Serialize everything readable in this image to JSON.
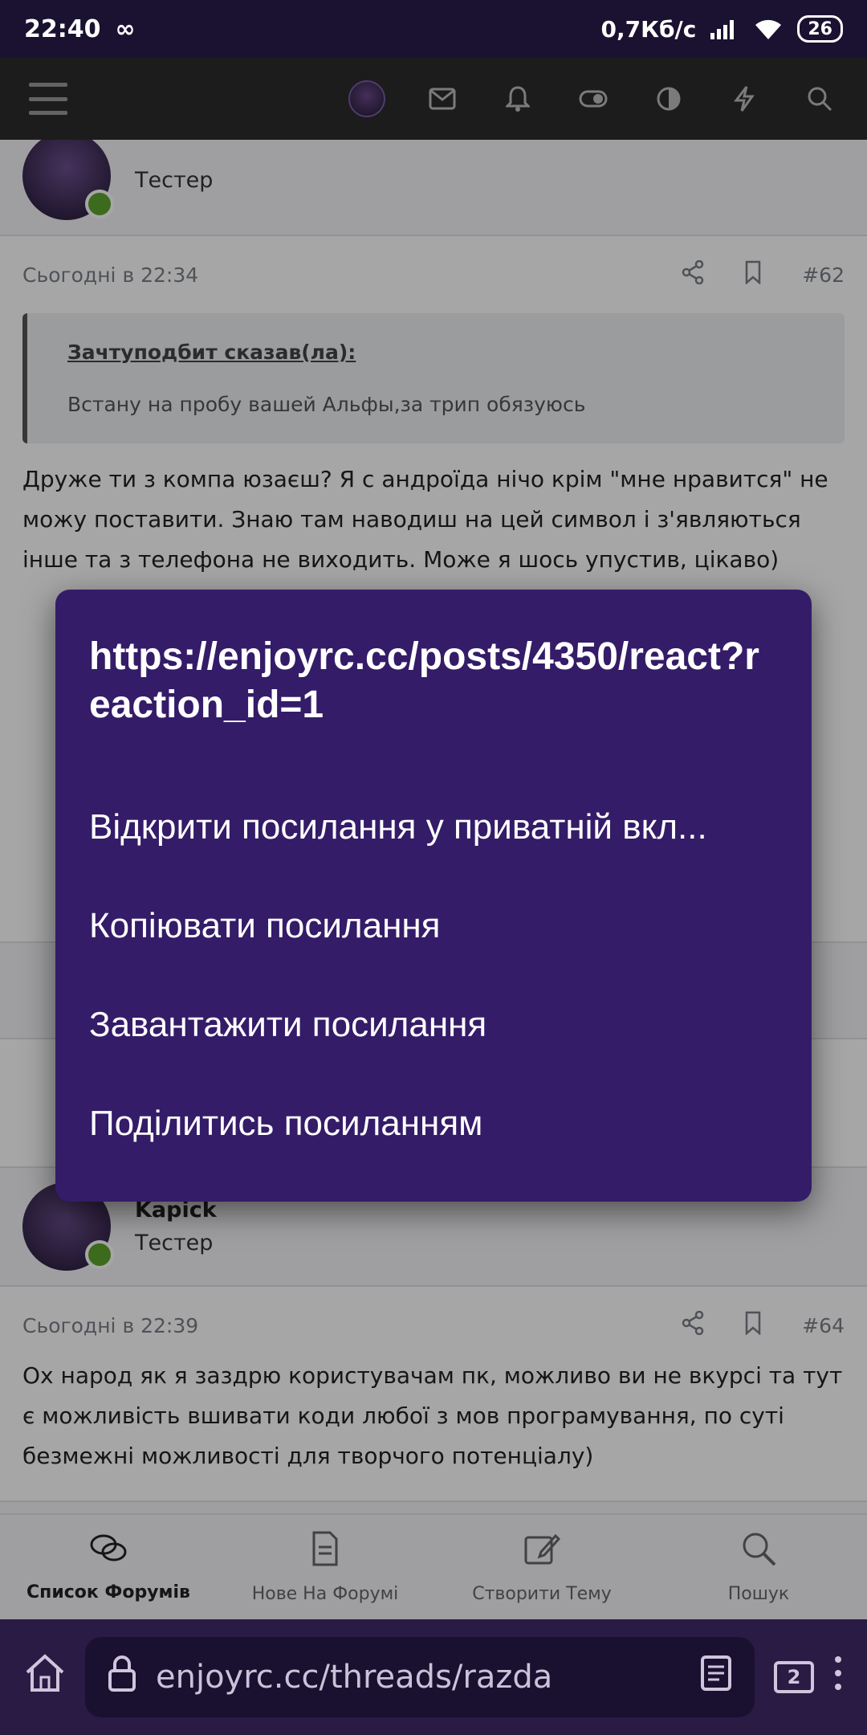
{
  "status_bar": {
    "time": "22:40",
    "infinity": "∞",
    "speed": "0,7Кб/с",
    "battery": "26"
  },
  "app_header": {
    "icons": [
      "menu-icon",
      "avatar",
      "mail-icon",
      "bell-icon",
      "toggle-icon",
      "contrast-icon",
      "bolt-icon",
      "search-icon"
    ]
  },
  "posts": [
    {
      "role": "Тестер"
    },
    {
      "time": "Сьогодні в 22:34",
      "number": "#62",
      "quote_author": "Зачтуподбит сказав(ла):",
      "quote_text": "Встану на пробу вашей Альфы,за трип обязуюсь",
      "text": "Друже ти з компа юзаєш? Я с андроїда нічо крім \"мне нравится\" не можу поставити. Знаю там наводиш на цей символ і з'являються інше та з телефона не виходить. Може я шось упустив, цікаво)"
    },
    {
      "name": "Kapick",
      "role": "Тестер",
      "time": "Сьогодні в 22:39",
      "number": "#64",
      "text": "Ох народ як я заздрю користувачам пк, можливо ви не вкурсі та тут є можливість вшивати коди любої з мов програмування, по суті безмежні можливості для творчого потенціалу)"
    }
  ],
  "forum_nav": [
    {
      "label": "Список Форумів",
      "icon": "chat-icon"
    },
    {
      "label": "Нове На Форумі",
      "icon": "document-icon"
    },
    {
      "label": "Створити Тему",
      "icon": "edit-icon"
    },
    {
      "label": "Пошук",
      "icon": "search-icon"
    }
  ],
  "browser": {
    "url": "enjoyrc.cc/threads/razdа",
    "tab_count": "2"
  },
  "context_menu": {
    "title": "https://enjoyrc.cc/posts/4350/react?reaction_id=1",
    "items": [
      "Відкрити посилання у приватній вкл...",
      "Копіювати посилання",
      "Завантажити посилання",
      "Поділитись посиланням"
    ]
  }
}
